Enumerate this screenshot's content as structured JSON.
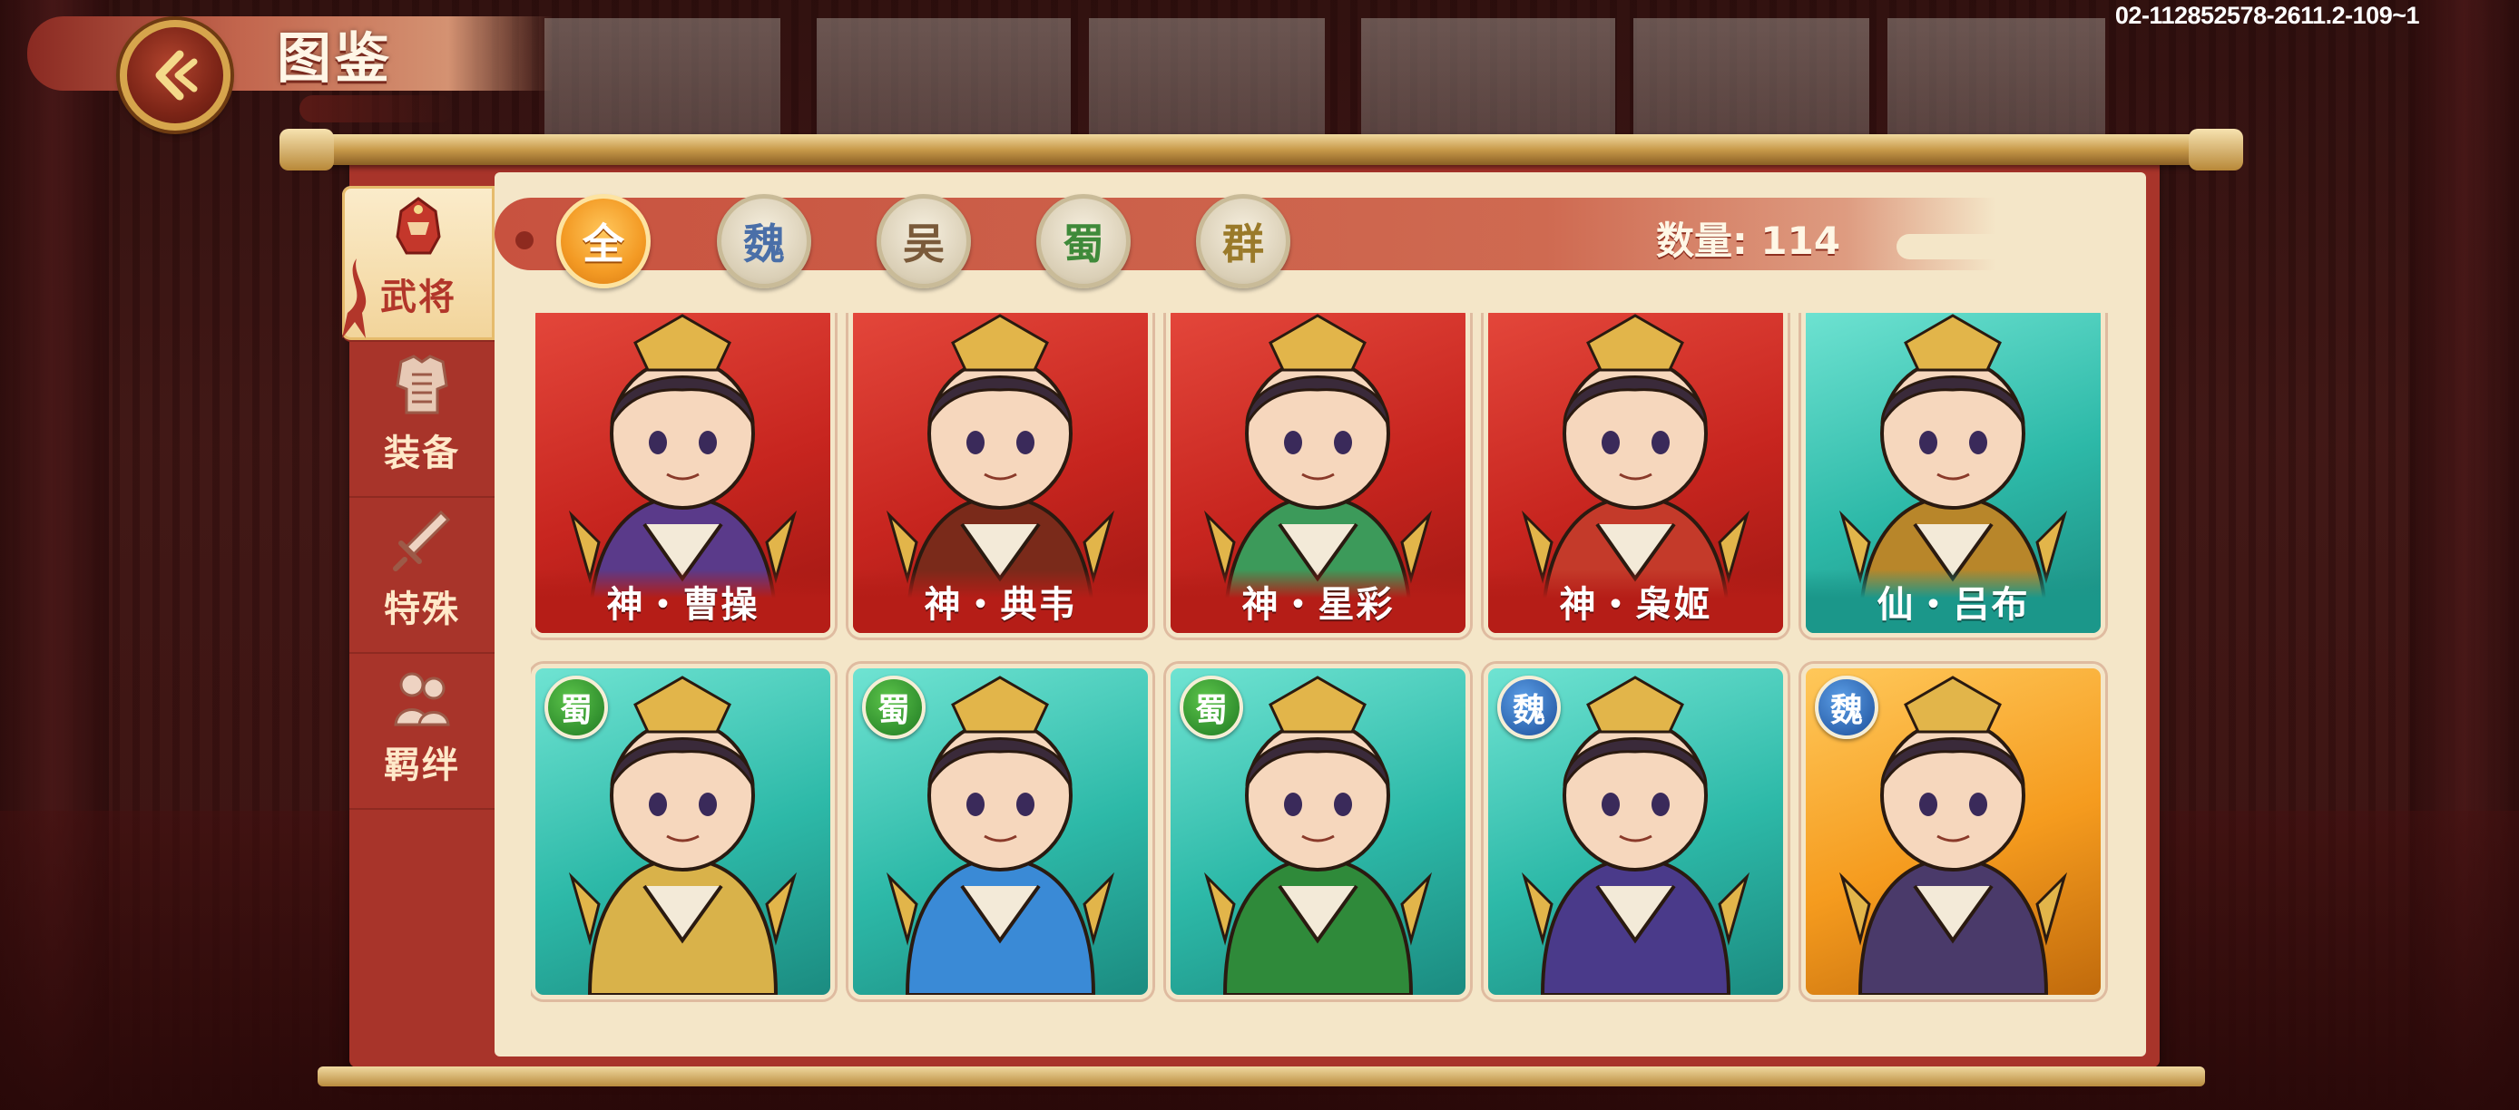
{
  "header": {
    "title": "图鉴",
    "debug_id": "02-112852578-2611.2-109~1"
  },
  "side_tabs": [
    {
      "label": "武将",
      "icon": "helmet-icon",
      "active": true
    },
    {
      "label": "装备",
      "icon": "armor-icon",
      "active": false
    },
    {
      "label": "特殊",
      "icon": "sword-icon",
      "active": false
    },
    {
      "label": "羁绊",
      "icon": "characters-icon",
      "active": false
    }
  ],
  "filter": {
    "factions": [
      {
        "label": "全",
        "active": true,
        "color": "#ffffff"
      },
      {
        "label": "魏",
        "active": false,
        "color": "#4a6fa8"
      },
      {
        "label": "吴",
        "active": false,
        "color": "#7a5a3a"
      },
      {
        "label": "蜀",
        "active": false,
        "color": "#3f8a3a"
      },
      {
        "label": "群",
        "active": false,
        "color": "#9a7a2a"
      }
    ],
    "count_label": "数量: 114"
  },
  "cards": [
    {
      "name": "神・曹操",
      "tier": "red",
      "faction": null,
      "art_color": "#5a3a8a"
    },
    {
      "name": "神・典韦",
      "tier": "red",
      "faction": null,
      "art_color": "#7a2a1a"
    },
    {
      "name": "神・星彩",
      "tier": "red",
      "faction": null,
      "art_color": "#3c9a5a"
    },
    {
      "name": "神・枭姬",
      "tier": "red",
      "faction": null,
      "art_color": "#c43a2a"
    },
    {
      "name": "仙・吕布",
      "tier": "teal",
      "faction": null,
      "art_color": "#b8862a"
    },
    {
      "name": "",
      "tier": "teal",
      "faction": {
        "label": "蜀",
        "kind": "shu"
      },
      "art_color": "#d9b24a"
    },
    {
      "name": "",
      "tier": "teal",
      "faction": {
        "label": "蜀",
        "kind": "shu"
      },
      "art_color": "#3a8ad6"
    },
    {
      "name": "",
      "tier": "teal",
      "faction": {
        "label": "蜀",
        "kind": "shu"
      },
      "art_color": "#2f8a3a"
    },
    {
      "name": "",
      "tier": "teal",
      "faction": {
        "label": "魏",
        "kind": "wei"
      },
      "art_color": "#4a3a8a"
    },
    {
      "name": "",
      "tier": "gold",
      "faction": {
        "label": "魏",
        "kind": "wei"
      },
      "art_color": "#4a3a6a"
    }
  ]
}
